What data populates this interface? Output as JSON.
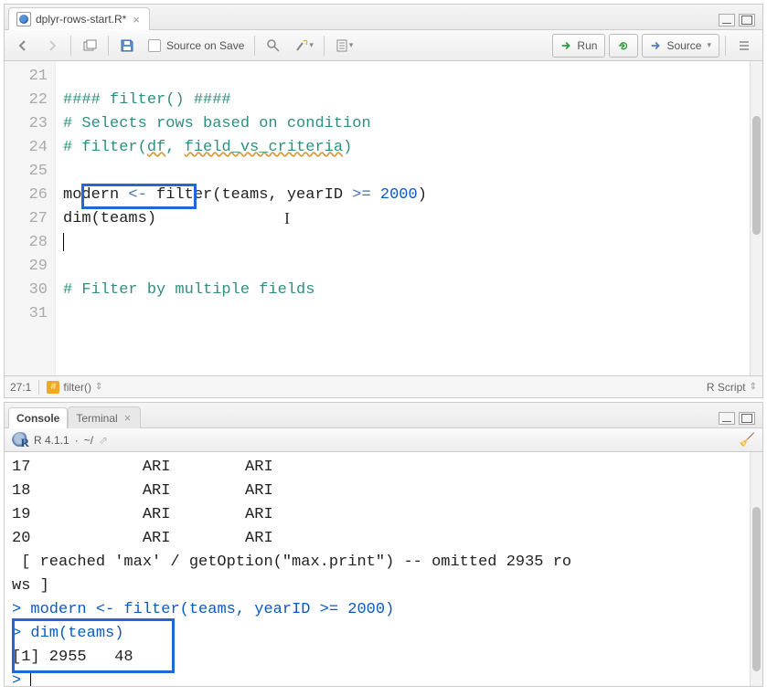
{
  "editor": {
    "tab_title": "dplyr-rows-start.R*",
    "toolbar": {
      "source_on_save": "Source on Save",
      "run": "Run",
      "source": "Source"
    },
    "gutter": [
      "21",
      "22",
      "23",
      "24",
      "25",
      "26",
      "27",
      "28",
      "29",
      "30",
      "31"
    ],
    "lines": {
      "l21": "#### filter() ####",
      "l22": "# Selects rows based on condition",
      "l23_a": "# filter(",
      "l23_df": "df",
      "l23_b": ", ",
      "l23_fc": "field_vs_criteria",
      "l23_c": ")",
      "l24": "",
      "l25_a": "modern ",
      "l25_op": "<-",
      "l25_b": " filter(teams, yearID ",
      "l25_ge": ">=",
      "l25_sp": " ",
      "l25_num": "2000",
      "l25_c": ")",
      "l26": "dim(teams)",
      "l27": "",
      "l28": "",
      "l29": "# Filter by multiple fields",
      "l30": "",
      "l31": ""
    },
    "status": {
      "cursor_pos": "27:1",
      "section": "filter()",
      "file_type": "R Script"
    }
  },
  "console": {
    "tabs": {
      "console": "Console",
      "terminal": "Terminal"
    },
    "r_version": "R 4.1.1",
    "working_dir": "~/",
    "output_rows": [
      "17            ARI        ARI",
      "18            ARI        ARI",
      "19            ARI        ARI",
      "20            ARI        ARI",
      " [ reached 'max' / getOption(\"max.print\") -- omitted 2935 ro",
      "ws ]"
    ],
    "cmd1_a": "modern ",
    "cmd1_op": "<-",
    "cmd1_b": " filter(teams, yearID ",
    "cmd1_ge": ">=",
    "cmd1_sp": " ",
    "cmd1_num": "2000",
    "cmd1_c": ")",
    "cmd2": "dim(teams)",
    "result": "[1] 2955   48",
    "prompt": ">"
  }
}
